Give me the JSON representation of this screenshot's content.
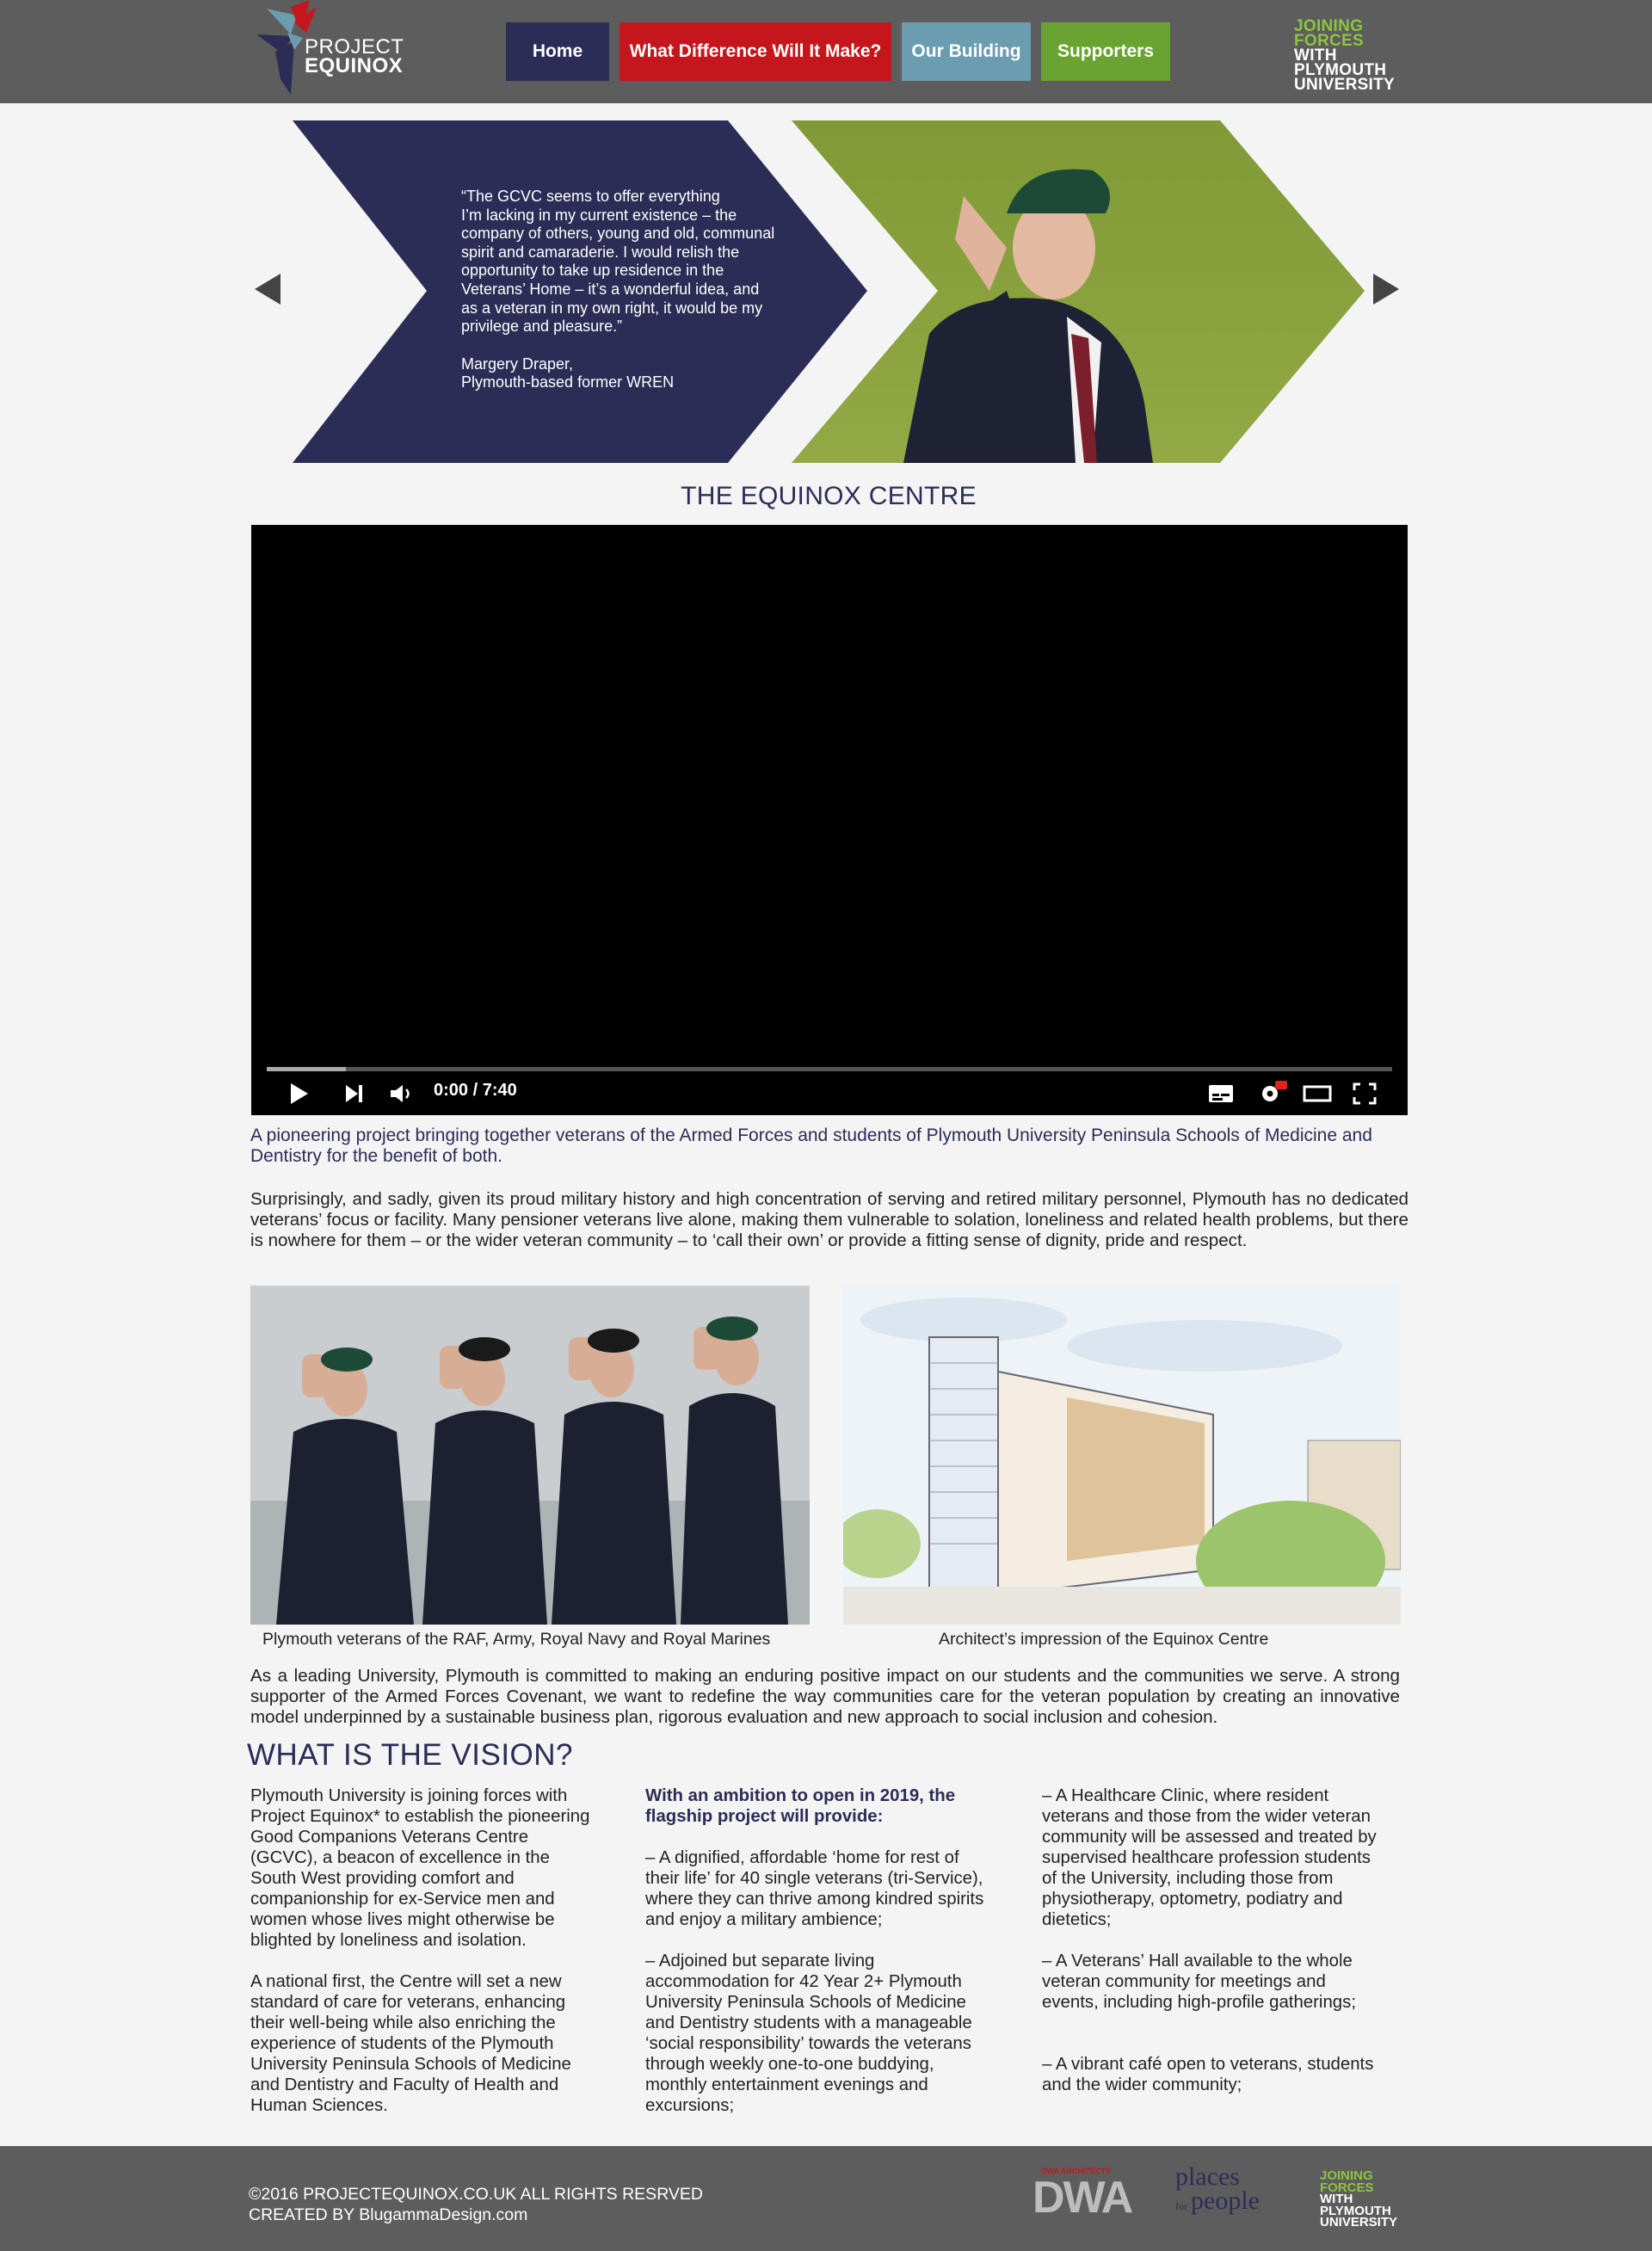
{
  "header": {
    "logo_line1": "PROJECT",
    "logo_line2": "EQUINOX",
    "nav": [
      {
        "label": "Home",
        "color": "#2b2d56"
      },
      {
        "label": "What Difference Will It Make?",
        "color": "#c4161c"
      },
      {
        "label": "Our Building",
        "color": "#6b9cb0"
      },
      {
        "label": "Supporters",
        "color": "#6aa332"
      }
    ],
    "partner": [
      "JOINING",
      "FORCES",
      "WITH",
      "PLYMOUTH",
      "UNIVERSITY"
    ]
  },
  "slider": {
    "quote_lines": [
      "“The GCVC seems to offer everything",
      "I’m lacking in my current existence – the",
      "company of others, young and old, communal",
      "spirit and camaraderie. I would relish the",
      "opportunity to take up residence in the",
      "Veterans’ Home – it’s a wonderful idea, and",
      "as a veteran in my own right, it would be my",
      "privilege and pleasure.”"
    ],
    "attribution_name": "Margery Draper,",
    "attribution_role": "Plymouth-based former WREN",
    "prev_icon": "arrow-left-icon",
    "next_icon": "arrow-right-icon",
    "panel_color": "#2b2d56",
    "accent_color": "#8a9a3b"
  },
  "centre": {
    "title": "THE EQUINOX CENTRE",
    "video": {
      "time": "0:00 / 7:40",
      "progress_buffered": 0.07
    },
    "intro": "A pioneering project bringing together veterans of the Armed Forces and students of Plymouth University Peninsula Schools of Medicine and Dentistry for the benefit of both.",
    "paragraph": "Surprisingly, and sadly, given its proud military history and high concentration of serving and retired military personnel, Plymouth has no dedicated veterans’ focus or facility. Many pensioner veterans live alone, making them vulnerable to solation, loneliness and related health problems, but there is nowhere for them – or the wider veteran community – to ‘call their own’ or provide a fitting sense of dignity, pride and respect."
  },
  "gallery": {
    "caption_left": "Plymouth veterans of the RAF, Army, Royal Navy and Royal Marines",
    "caption_right": "Architect’s impression of the Equinox Centre"
  },
  "university_paragraph": "As a leading University, Plymouth is committed to making an enduring positive impact on our students and the communities we serve. A strong supporter of the Armed Forces Covenant, we want to redefine the way communities care for the veteran population by creating an innovative model underpinned by a sustainable business plan, rigorous evaluation and new approach to social inclusion and cohesion.",
  "vision": {
    "title": "WHAT IS THE VISION?",
    "col1": [
      "Plymouth University is joining forces with Project Equinox* to establish the pioneering Good Companions Veterans Centre (GCVC), a beacon of excellence in the South West providing comfort and companionship for ex-Service men and women whose lives might otherwise be blighted by loneliness and isolation.",
      "A national first, the Centre will set a new standard of care for veterans, enhancing their well-being while also enriching the experience of students of the Plymouth University Peninsula Schools of Medicine and Dentistry and Faculty of Health and Human Sciences."
    ],
    "col2_heading": "With an ambition to open in 2019, the flagship project will provide:",
    "col2": [
      "–  A dignified, affordable ‘home for rest of their life’ for 40 single veterans (tri-Service), where they can thrive among kindred spirits and enjoy a military ambience;",
      "–  Adjoined but separate living accommodation for 42 Year 2+ Plymouth University Peninsula Schools of Medicine and Dentistry students with a manageable ‘social responsibility’ towards the veterans through weekly one-to-one buddying, monthly entertainment evenings and excursions;"
    ],
    "col3": [
      "– A Healthcare Clinic, where resident veterans and those from the wider veteran community will be assessed and treated by supervised healthcare profession students of the University, including those from physiotherapy, optometry, podiatry and dietetics;",
      "– A Veterans’ Hall available to  the whole veteran community  for meetings and events,  including high-profile gatherings;",
      "– A vibrant café open to veterans, students and the wider community;"
    ]
  },
  "footer": {
    "copyright": "©2016 PROJECTEQUINOX.CO.UK ALL RIGHTS RESRVED",
    "credit": "CREATED BY BlugammaDesign.com",
    "dwa_small": "DWA ARCHITECTS",
    "dwa": "DWA",
    "places_line1": "places",
    "places_line2": "people",
    "places_for": "for",
    "partner": [
      "JOINING",
      "FORCES",
      "WITH",
      "PLYMOUTH",
      "UNIVERSITY"
    ]
  }
}
